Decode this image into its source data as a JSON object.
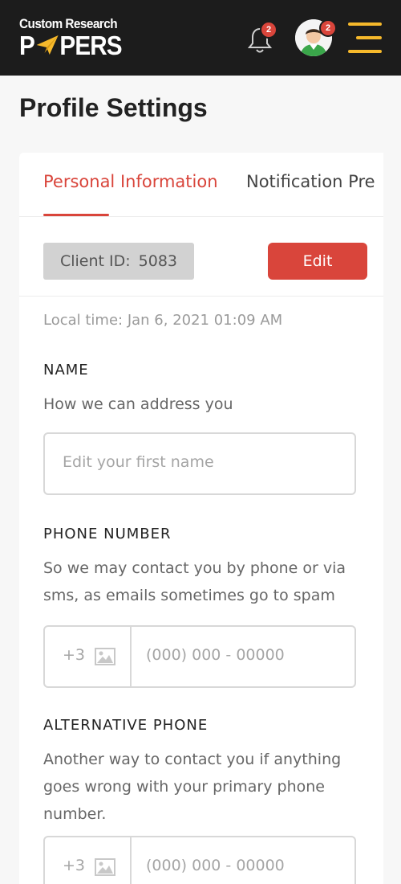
{
  "header": {
    "logo_line1": "Custom Research",
    "logo_part1": "P",
    "logo_part2": "PERS",
    "notifications_count": "2",
    "messages_count": "2"
  },
  "page_title": "Profile Settings",
  "tabs": [
    {
      "label": "Personal Information",
      "active": true
    },
    {
      "label": "Notification Pre",
      "active": false
    }
  ],
  "client": {
    "id_label": "Client ID:",
    "id_value": "5083",
    "edit_label": "Edit"
  },
  "local_time": "Local time: Jan 6, 2021  01:09 AM",
  "fields": {
    "name": {
      "label": "NAME",
      "hint": "How we can address you",
      "placeholder": "Edit your first name"
    },
    "phone": {
      "label": "PHONE NUMBER",
      "hint": "So we may contact you by phone or via sms, as emails sometimes go to spam",
      "prefix": "+3",
      "placeholder": "(000) 000 - 00000"
    },
    "alt_phone": {
      "label": "ALTERNATIVE PHONE",
      "hint": "Another way to contact you if anything goes wrong with your primary phone number.",
      "prefix": "+3",
      "placeholder": "(000) 000 - 00000"
    }
  },
  "colors": {
    "accent": "#d9453b",
    "brand_yellow": "#f6b92b",
    "header_bg": "#1c1c1c"
  }
}
